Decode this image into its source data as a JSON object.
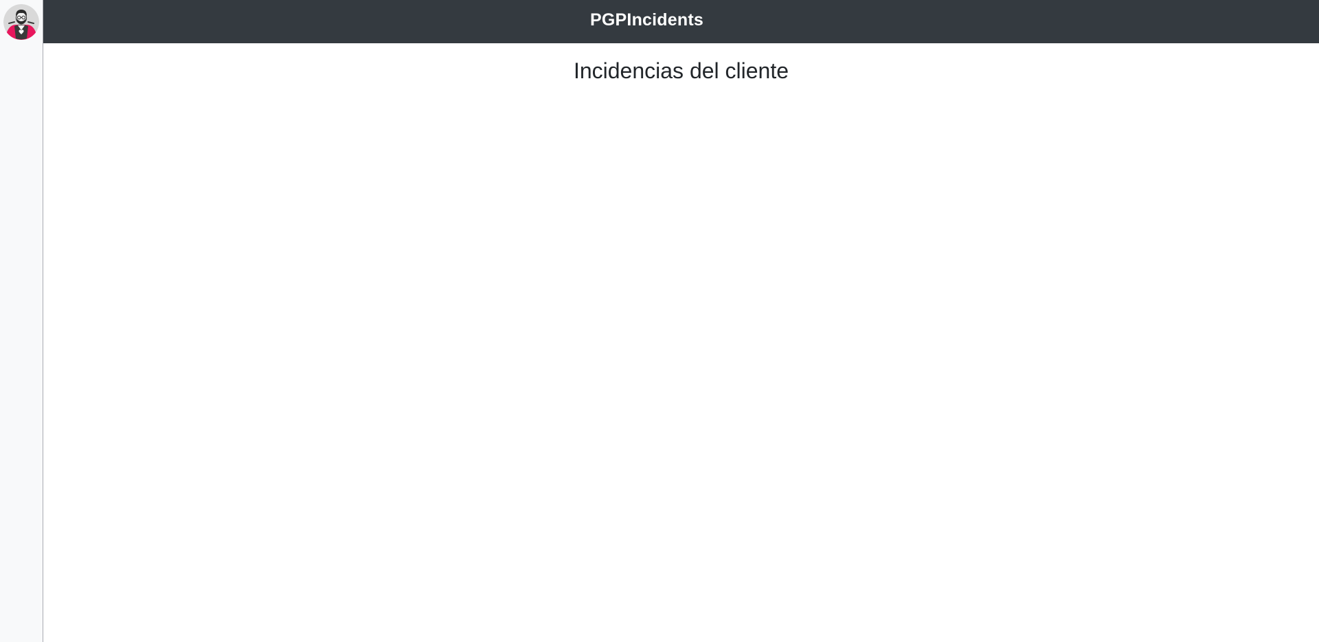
{
  "app": {
    "brand": "PGPIncidents"
  },
  "sidebar": {
    "avatar_icon": "user-avatar-icon"
  },
  "main": {
    "title": "Incidencias del cliente"
  },
  "colors": {
    "topbar_bg": "#343a40",
    "sidebar_bg": "#f8f9fa",
    "brand_text": "#ffffff",
    "title_text": "#212529",
    "avatar_accent": "#e8175d"
  }
}
